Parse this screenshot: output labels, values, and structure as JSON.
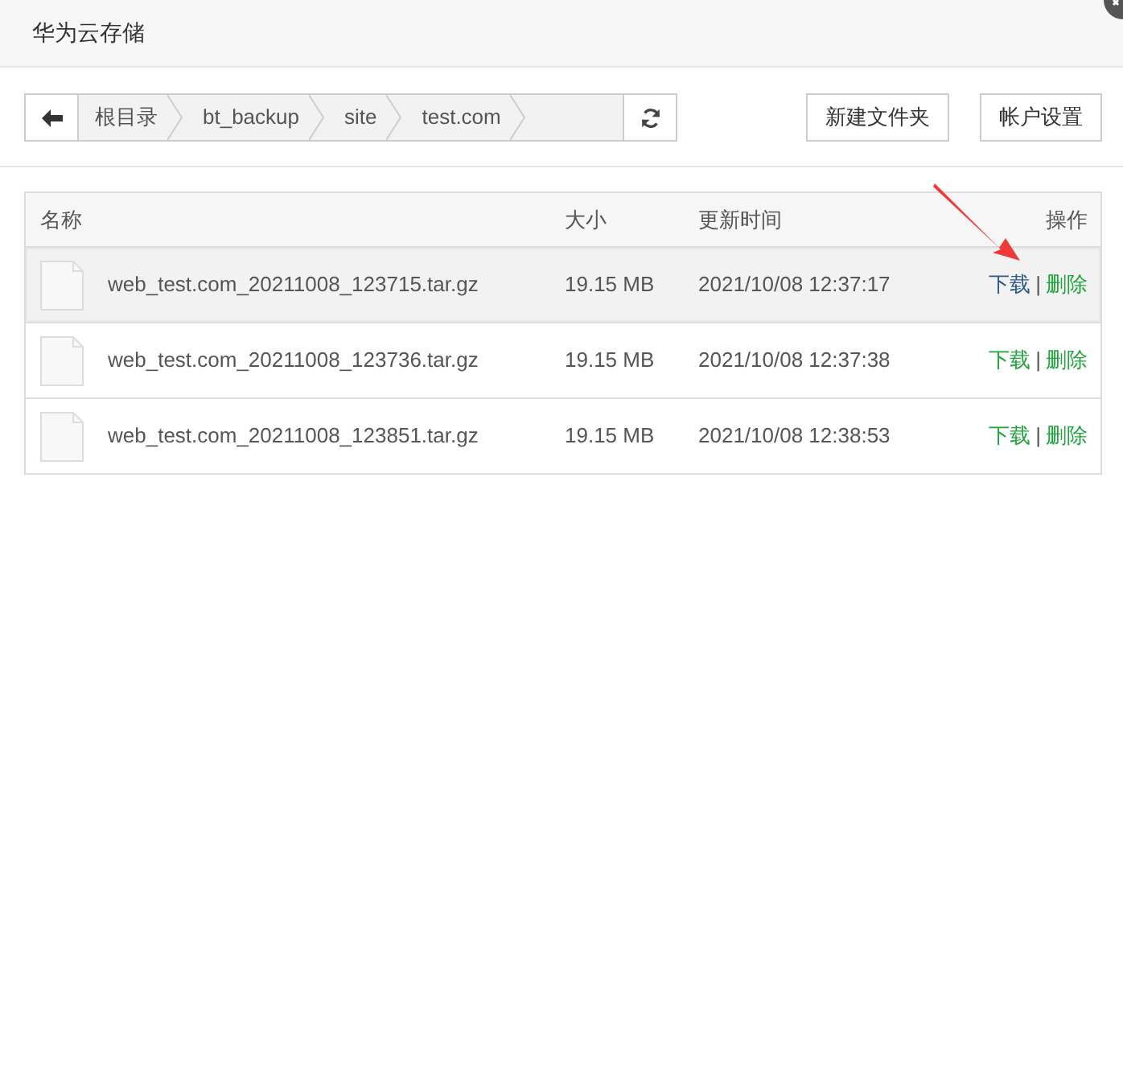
{
  "window": {
    "title": "华为云存储"
  },
  "toolbar": {
    "breadcrumbs": [
      "根目录",
      "bt_backup",
      "site",
      "test.com"
    ],
    "buttons": [
      "新建文件夹",
      "帐户设置"
    ]
  },
  "table": {
    "columns": [
      "名称",
      "大小",
      "更新时间",
      "操作"
    ],
    "rows": [
      {
        "name": "web_test.com_20211008_123715.tar.gz",
        "size": "19.15 MB",
        "time": "2021/10/08 12:37:17",
        "download": "下载",
        "separator": "|",
        "delete": "删除",
        "hovered": true,
        "download_hovered": true
      },
      {
        "name": "web_test.com_20211008_123736.tar.gz",
        "size": "19.15 MB",
        "time": "2021/10/08 12:37:38",
        "download": "下载",
        "separator": "|",
        "delete": "删除",
        "hovered": false,
        "download_hovered": false
      },
      {
        "name": "web_test.com_20211008_123851.tar.gz",
        "size": "19.15 MB",
        "time": "2021/10/08 12:38:53",
        "download": "下载",
        "separator": "|",
        "delete": "删除",
        "hovered": false,
        "download_hovered": false
      }
    ]
  }
}
